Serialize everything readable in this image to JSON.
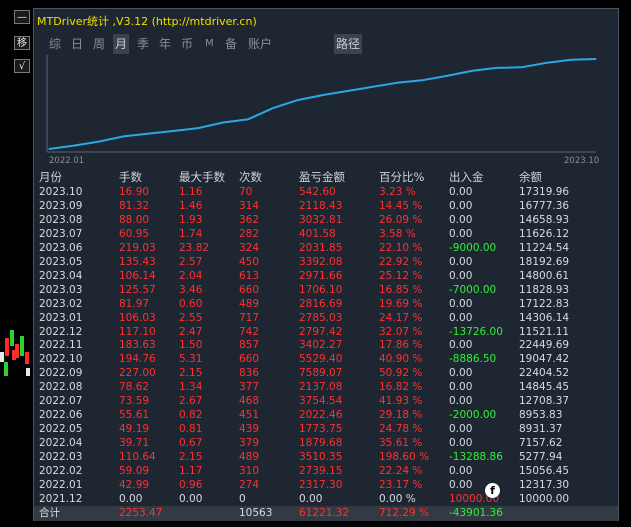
{
  "window": {
    "title": "MTDriver统计 ,V3.12 (http://mtdriver.cn)"
  },
  "side_buttons": {
    "minimize": "—",
    "move": "移",
    "check": "√"
  },
  "tabs": [
    {
      "label": "综",
      "active": false
    },
    {
      "label": "日",
      "active": false
    },
    {
      "label": "周",
      "active": false
    },
    {
      "label": "月",
      "active": true
    },
    {
      "label": "季",
      "active": false
    },
    {
      "label": "年",
      "active": false
    },
    {
      "label": "币",
      "active": false
    },
    {
      "label": "M",
      "active": false
    },
    {
      "label": "备",
      "active": false
    },
    {
      "label": "账户",
      "active": false
    },
    {
      "label": "路径",
      "active": true
    }
  ],
  "chart_data": {
    "type": "line",
    "x_start_label": "2022.01",
    "x_end_label": "2023.10",
    "series": [
      {
        "color": "#29a8e6",
        "x": [
          "2021.12",
          "2022.01",
          "2022.02",
          "2022.03",
          "2022.04",
          "2022.05",
          "2022.06",
          "2022.07",
          "2022.08",
          "2022.09",
          "2022.10",
          "2022.11",
          "2022.12",
          "2023.01",
          "2023.02",
          "2023.03",
          "2023.04",
          "2023.05",
          "2023.06",
          "2023.07",
          "2023.08",
          "2023.09",
          "2023.10"
        ],
        "values": [
          0,
          2317.3,
          5056.45,
          8566.8,
          10446.48,
          12220.23,
          14242.69,
          17997.23,
          20134.31,
          27723.38,
          33253.78,
          36656.05,
          39453.47,
          42238.5,
          45054.97,
          46761.07,
          49732.73,
          53125.01,
          55156.86,
          55558.47,
          58591.28,
          60708.11,
          61221.32
        ]
      }
    ],
    "ylim": [
      0,
      61221.32
    ]
  },
  "table": {
    "headers": [
      "月份",
      "手数",
      "最大手数",
      "次数",
      "盈亏金额",
      "百分比%",
      "出入金",
      "余额"
    ],
    "rows": [
      {
        "month": "2023.10",
        "lots": "16.90",
        "max_lots": "1.16",
        "count": "70",
        "pnl": "542.60",
        "pct": "3.23 %",
        "flow": "0.00",
        "balance": "17319.96"
      },
      {
        "month": "2023.09",
        "lots": "81.32",
        "max_lots": "1.46",
        "count": "314",
        "pnl": "2118.43",
        "pct": "14.45 %",
        "flow": "0.00",
        "balance": "16777.36"
      },
      {
        "month": "2023.08",
        "lots": "88.00",
        "max_lots": "1.93",
        "count": "362",
        "pnl": "3032.81",
        "pct": "26.09 %",
        "flow": "0.00",
        "balance": "14658.93"
      },
      {
        "month": "2023.07",
        "lots": "60.95",
        "max_lots": "1.74",
        "count": "282",
        "pnl": "401.58",
        "pct": "3.58 %",
        "flow": "0.00",
        "balance": "11626.12"
      },
      {
        "month": "2023.06",
        "lots": "219.03",
        "max_lots": "23.82",
        "count": "324",
        "pnl": "2031.85",
        "pct": "22.10 %",
        "flow": "-9000.00",
        "balance": "11224.54"
      },
      {
        "month": "2023.05",
        "lots": "135.43",
        "max_lots": "2.57",
        "count": "450",
        "pnl": "3392.08",
        "pct": "22.92 %",
        "flow": "0.00",
        "balance": "18192.69"
      },
      {
        "month": "2023.04",
        "lots": "106.14",
        "max_lots": "2.04",
        "count": "613",
        "pnl": "2971.66",
        "pct": "25.12 %",
        "flow": "0.00",
        "balance": "14800.61"
      },
      {
        "month": "2023.03",
        "lots": "125.57",
        "max_lots": "3.46",
        "count": "660",
        "pnl": "1706.10",
        "pct": "16.85 %",
        "flow": "-7000.00",
        "balance": "11828.93"
      },
      {
        "month": "2023.02",
        "lots": "81.97",
        "max_lots": "0.60",
        "count": "489",
        "pnl": "2816.69",
        "pct": "19.69 %",
        "flow": "0.00",
        "balance": "17122.83"
      },
      {
        "month": "2023.01",
        "lots": "106.03",
        "max_lots": "2.55",
        "count": "717",
        "pnl": "2785.03",
        "pct": "24.17 %",
        "flow": "0.00",
        "balance": "14306.14"
      },
      {
        "month": "2022.12",
        "lots": "117.10",
        "max_lots": "2.47",
        "count": "742",
        "pnl": "2797.42",
        "pct": "32.07 %",
        "flow": "-13726.00",
        "balance": "11521.11"
      },
      {
        "month": "2022.11",
        "lots": "183.63",
        "max_lots": "1.50",
        "count": "857",
        "pnl": "3402.27",
        "pct": "17.86 %",
        "flow": "0.00",
        "balance": "22449.69"
      },
      {
        "month": "2022.10",
        "lots": "194.76",
        "max_lots": "5.31",
        "count": "660",
        "pnl": "5529.40",
        "pct": "40.90 %",
        "flow": "-8886.50",
        "balance": "19047.42"
      },
      {
        "month": "2022.09",
        "lots": "227.00",
        "max_lots": "2.15",
        "count": "836",
        "pnl": "7589.07",
        "pct": "50.92 %",
        "flow": "0.00",
        "balance": "22404.52"
      },
      {
        "month": "2022.08",
        "lots": "78.62",
        "max_lots": "1.34",
        "count": "377",
        "pnl": "2137.08",
        "pct": "16.82 %",
        "flow": "0.00",
        "balance": "14845.45"
      },
      {
        "month": "2022.07",
        "lots": "73.59",
        "max_lots": "2.67",
        "count": "468",
        "pnl": "3754.54",
        "pct": "41.93 %",
        "flow": "0.00",
        "balance": "12708.37"
      },
      {
        "month": "2022.06",
        "lots": "55.61",
        "max_lots": "0.82",
        "count": "451",
        "pnl": "2022.46",
        "pct": "29.18 %",
        "flow": "-2000.00",
        "balance": "8953.83"
      },
      {
        "month": "2022.05",
        "lots": "49.19",
        "max_lots": "0.81",
        "count": "439",
        "pnl": "1773.75",
        "pct": "24.78 %",
        "flow": "0.00",
        "balance": "8931.37"
      },
      {
        "month": "2022.04",
        "lots": "39.71",
        "max_lots": "0.67",
        "count": "379",
        "pnl": "1879.68",
        "pct": "35.61 %",
        "flow": "0.00",
        "balance": "7157.62"
      },
      {
        "month": "2022.03",
        "lots": "110.64",
        "max_lots": "2.15",
        "count": "489",
        "pnl": "3510.35",
        "pct": "198.60 %",
        "flow": "-13288.86",
        "balance": "5277.94"
      },
      {
        "month": "2022.02",
        "lots": "59.09",
        "max_lots": "1.17",
        "count": "310",
        "pnl": "2739.15",
        "pct": "22.24 %",
        "flow": "0.00",
        "balance": "15056.45"
      },
      {
        "month": "2022.01",
        "lots": "42.99",
        "max_lots": "0.96",
        "count": "274",
        "pnl": "2317.30",
        "pct": "23.17 %",
        "flow": "0.00",
        "balance": "12317.30"
      },
      {
        "month": "2021.12",
        "lots": "0.00",
        "max_lots": "0.00",
        "count": "0",
        "pnl": "0.00",
        "pct": "0.00 %",
        "flow": "10000.00",
        "balance": "10000.00"
      }
    ],
    "total": {
      "month": "合计",
      "lots": "2253.47",
      "max_lots": "",
      "count": "10563",
      "pnl": "61221.32",
      "pct": "712.29 %",
      "flow": "-43901.36",
      "balance": ""
    }
  },
  "watermark": {
    "logo_letter": "f"
  },
  "colors": {
    "panel_bg": "#1e2631",
    "title": "#f2e000",
    "positive_red": "#ff3030",
    "negative_green": "#2ef03a",
    "line": "#29a8e6"
  }
}
